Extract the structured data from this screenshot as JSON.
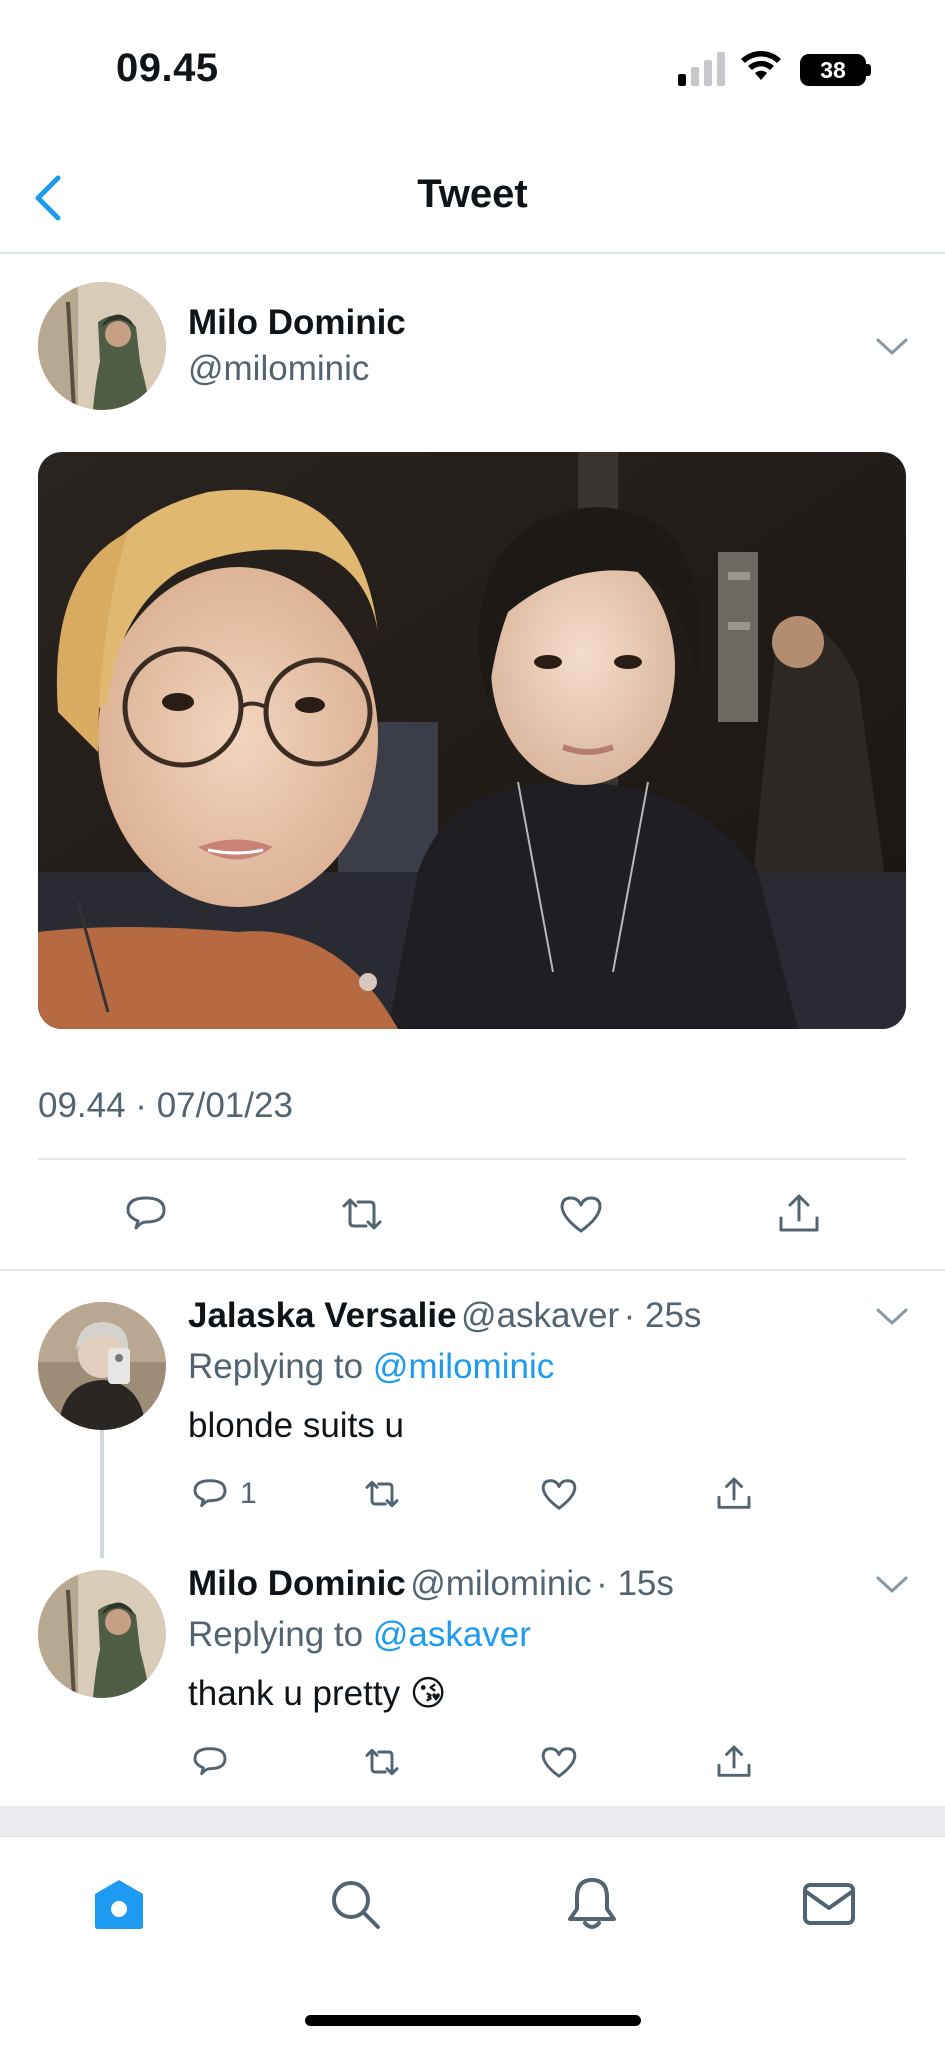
{
  "status_bar": {
    "time": "09.45",
    "battery": "38"
  },
  "nav": {
    "title": "Tweet"
  },
  "tweet": {
    "author_name": "Milo Dominic",
    "author_handle": "@milominic",
    "timestamp": "09.44 · 07/01/23"
  },
  "replies": [
    {
      "name": "Jalaska Versalie",
      "handle": "@askaver",
      "age": "· 25s",
      "replying_label": "Replying to",
      "replying_to": "@milominic",
      "text": "blonde suits u",
      "reply_count": "1"
    },
    {
      "name": "Milo Dominic",
      "handle": "@milominic",
      "age": "· 15s",
      "replying_label": "Replying to",
      "replying_to": "@askaver",
      "text": "thank u pretty",
      "emoji": "😘"
    }
  ],
  "tabs": [
    "home-icon",
    "search-icon",
    "bell-icon",
    "mail-icon"
  ],
  "colors": {
    "accent": "#1d9bf0",
    "muted": "#536471",
    "text": "#0f1419"
  }
}
